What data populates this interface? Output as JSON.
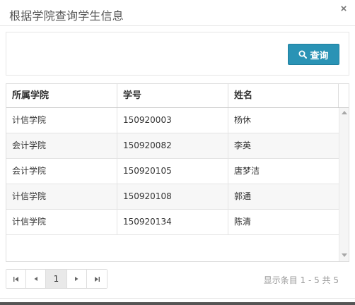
{
  "dialog": {
    "title": "根据学院查询学生信息",
    "close_symbol": "×"
  },
  "toolbar": {
    "query_label": "查询",
    "query_icon": "search-icon"
  },
  "table": {
    "columns": [
      "所属学院",
      "学号",
      "姓名"
    ],
    "rows": [
      [
        "计信学院",
        "150920003",
        "杨休"
      ],
      [
        "会计学院",
        "150920082",
        "李英"
      ],
      [
        "会计学院",
        "150920105",
        "唐梦洁"
      ],
      [
        "计信学院",
        "150920108",
        "郭通"
      ],
      [
        "计信学院",
        "150920134",
        "陈清"
      ]
    ]
  },
  "pagination": {
    "current_page": "1",
    "info": "显示条目 1 - 5 共 5"
  }
}
